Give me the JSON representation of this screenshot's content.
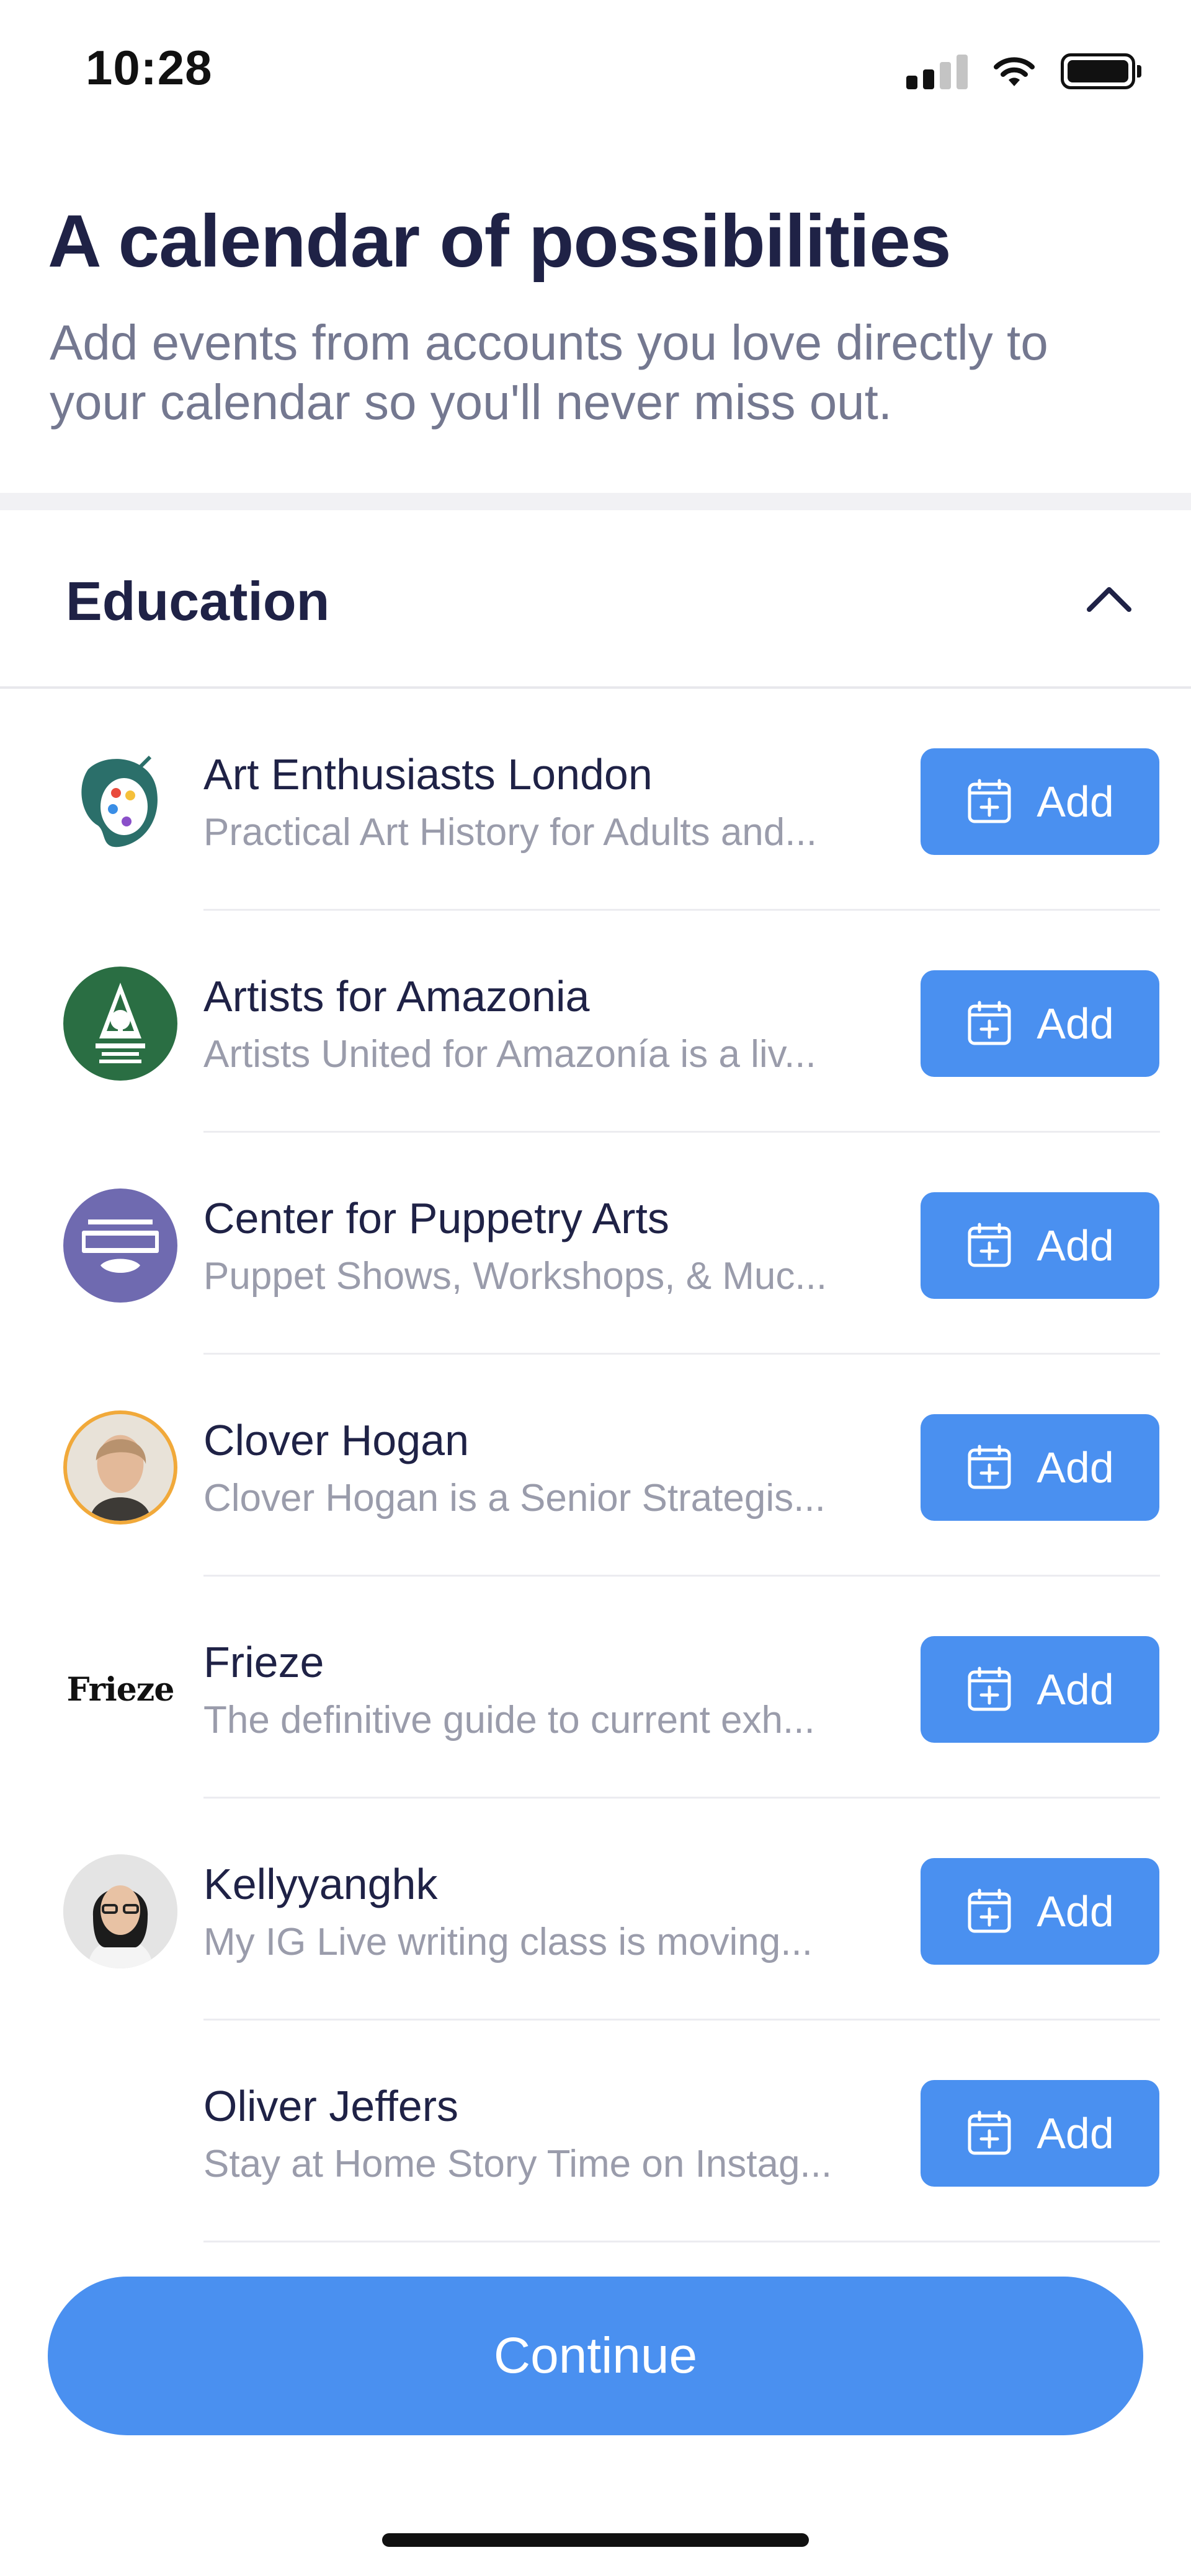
{
  "status_bar": {
    "time": "10:28"
  },
  "header": {
    "title": "A calendar of possibilities",
    "subtitle": "Add events from accounts you love directly to your calendar so you'll never miss out."
  },
  "section": {
    "title": "Education",
    "expanded": true,
    "chevron_icon": "chevron-up-icon"
  },
  "accounts": [
    {
      "name": "Art Enthusiasts London",
      "description": "Practical Art History for Adults and...",
      "add_label": "Add",
      "avatar_icon": "palette-logo"
    },
    {
      "name": "Artists for Amazonia",
      "description": "Artists United for Amazonía is a liv...",
      "add_label": "Add",
      "avatar_icon": "amazonia-logo"
    },
    {
      "name": "Center for Puppetry Arts",
      "description": "Puppet Shows, Workshops, & Muc...",
      "add_label": "Add",
      "avatar_icon": "puppetry-logo"
    },
    {
      "name": "Clover Hogan",
      "description": "Clover Hogan is a Senior Strategis...",
      "add_label": "Add",
      "avatar_icon": "person-photo"
    },
    {
      "name": "Frieze",
      "description": "The definitive guide to current exh...",
      "add_label": "Add",
      "avatar_text": "Frieze"
    },
    {
      "name": "Kellyyanghk",
      "description": "My IG Live writing class is moving...",
      "add_label": "Add",
      "avatar_icon": "person-photo"
    },
    {
      "name": "Oliver Jeffers",
      "description": "Stay at Home Story Time on Instag...",
      "add_label": "Add",
      "avatar_icon": "none"
    }
  ],
  "continue_label": "Continue",
  "colors": {
    "accent": "#4a90f0",
    "title": "#1f2246",
    "subtitle": "#747890",
    "muted": "#9a9cab"
  }
}
